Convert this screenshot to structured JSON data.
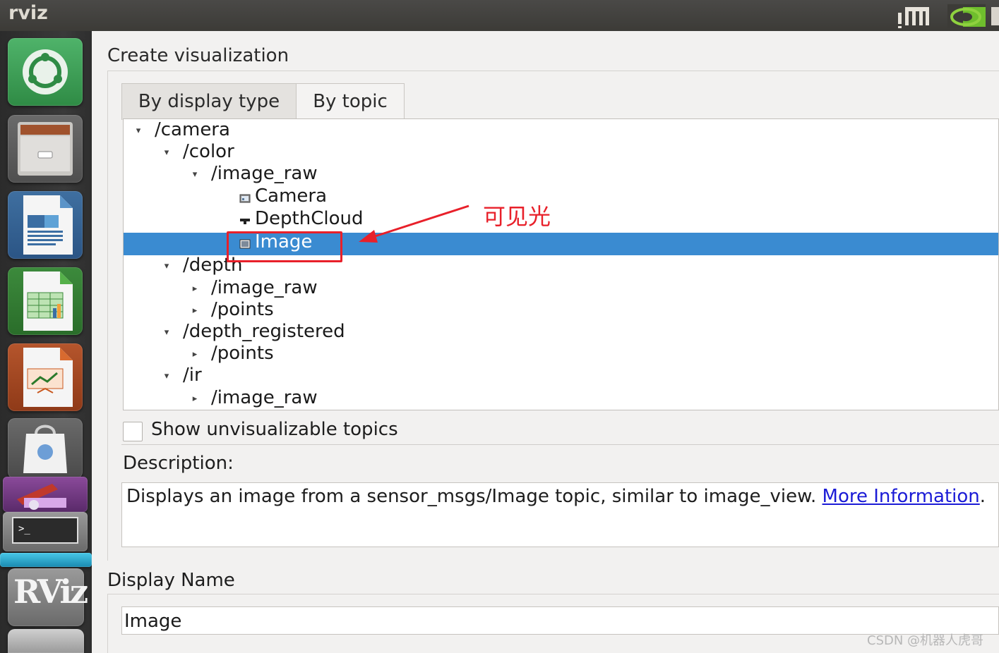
{
  "window": {
    "title": "rviz"
  },
  "launcher": {
    "items": [
      {
        "name": "ubuntu-dash-icon"
      },
      {
        "name": "file-cabinet-icon"
      },
      {
        "name": "writer-document-icon"
      },
      {
        "name": "calc-spreadsheet-icon"
      },
      {
        "name": "impress-presentation-icon"
      },
      {
        "name": "software-center-bag-icon"
      },
      {
        "name": "system-settings-icon"
      },
      {
        "name": "terminal-icon"
      },
      {
        "name": "rviz-app-icon",
        "label": "RViz"
      },
      {
        "name": "trash-icon"
      }
    ]
  },
  "dialog": {
    "heading": "Create visualization",
    "tabs": [
      {
        "label": "By display type",
        "active": false
      },
      {
        "label": "By topic",
        "active": true
      }
    ],
    "tree": [
      {
        "label": "/camera",
        "level": 0,
        "arrow": "▾"
      },
      {
        "label": "/color",
        "level": 1,
        "arrow": "▾"
      },
      {
        "label": "/image_raw",
        "level": 2,
        "arrow": "▾"
      },
      {
        "label": "Camera",
        "level": 3,
        "icon": "camera-display-icon"
      },
      {
        "label": "DepthCloud",
        "level": 3,
        "icon": "depthcloud-display-icon"
      },
      {
        "label": "Image",
        "level": 3,
        "icon": "image-display-icon",
        "selected": true
      },
      {
        "label": "/depth",
        "level": 1,
        "arrow": "▾"
      },
      {
        "label": "/image_raw",
        "level": 2,
        "arrow": "▸"
      },
      {
        "label": "/points",
        "level": 2,
        "arrow": "▸"
      },
      {
        "label": "/depth_registered",
        "level": 1,
        "arrow": "▾"
      },
      {
        "label": "/points",
        "level": 2,
        "arrow": "▸"
      },
      {
        "label": "/ir",
        "level": 1,
        "arrow": "▾"
      },
      {
        "label": "/image_raw",
        "level": 2,
        "arrow": "▸"
      }
    ],
    "show_unvisualizable": {
      "label": "Show unvisualizable topics",
      "checked": false
    },
    "description": {
      "heading": "Description:",
      "text": "Displays an image from a sensor_msgs/Image topic, similar to image_view. ",
      "link": "More Information",
      "after": "."
    },
    "display_name": {
      "heading": "Display Name",
      "value": "Image"
    }
  },
  "annotation": {
    "text": "可见光",
    "color": "#e8202a"
  },
  "watermark": "CSDN @机器人虎哥",
  "colors": {
    "selection": "#3a8bd1",
    "annotation": "#e8202a",
    "link": "#1b1bd6"
  }
}
